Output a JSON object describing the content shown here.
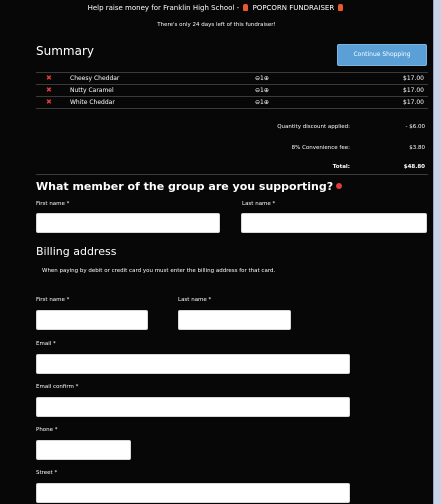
{
  "banner": {
    "line1_pre": "Help raise money for Franklin High School - ",
    "line1_post": " POPCORN FUNDRAISER ",
    "line2": "There's only 24 days left of this fundraiser!"
  },
  "summary": {
    "title": "Summary",
    "continue_label": "Continue Shopping",
    "items": [
      {
        "name": "Cheesy Cheddar",
        "qty": "⊖1⊕",
        "price": "$17.00"
      },
      {
        "name": "Nutty Caramel",
        "qty": "⊖1⊕",
        "price": "$17.00"
      },
      {
        "name": "White Cheddar",
        "qty": "⊖1⊕",
        "price": "$17.00"
      }
    ],
    "discount_label": "Quantity discount applied:",
    "discount_value": "- $6.00",
    "fee_label": "8% Convenience fee:",
    "fee_value": "$3.80",
    "total_label": "Total:",
    "total_value": "$48.80"
  },
  "member": {
    "heading": "What member of the group are you supporting?",
    "first_label": "First name *",
    "last_label": "Last name *"
  },
  "billing": {
    "heading": "Billing address",
    "note": "When paying by debit or credit card you must enter the billing address for that card.",
    "first_label": "First name *",
    "last_label": "Last name *",
    "email_label": "Email *",
    "email_confirm_label": "Email confirm *",
    "phone_label": "Phone *",
    "street_label": "Street *"
  },
  "colors": {
    "background": "#070707",
    "button": "#5a9fd6",
    "remove_icon": "#e33b3b"
  }
}
